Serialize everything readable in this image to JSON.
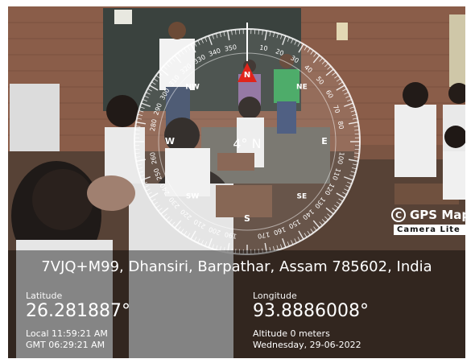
{
  "compass": {
    "heading_text": "4° N",
    "cardinals": {
      "n": "N",
      "ne": "NE",
      "e": "E",
      "se": "SE",
      "s": "S",
      "sw": "SW",
      "w": "W",
      "nw": "NW"
    },
    "degree_labels": [
      "10",
      "20",
      "30",
      "40",
      "50",
      "60",
      "70",
      "80",
      "100",
      "110",
      "120",
      "130",
      "140",
      "150",
      "160",
      "170",
      "190",
      "200",
      "210",
      "220",
      "230",
      "240",
      "250",
      "260",
      "280",
      "290",
      "300",
      "310",
      "320",
      "330",
      "340",
      "350"
    ]
  },
  "brand": {
    "logo_char": "C",
    "name": "GPS Map",
    "subtitle": "Camera Lite"
  },
  "location": {
    "address": "7VJQ+M99, Dhansiri, Barpathar, Assam 785602, India",
    "latitude_label": "Latitude",
    "latitude": "26.281887°",
    "longitude_label": "Longitude",
    "longitude": "93.8886008°",
    "local_time": "Local 11:59:21 AM",
    "gmt_time": "GMT 06:29:21 AM",
    "altitude": "Altitude 0 meters",
    "date": "Wednesday, 29-06-2022"
  },
  "colors": {
    "north_marker": "#e0241b",
    "overlay": "#000000"
  }
}
